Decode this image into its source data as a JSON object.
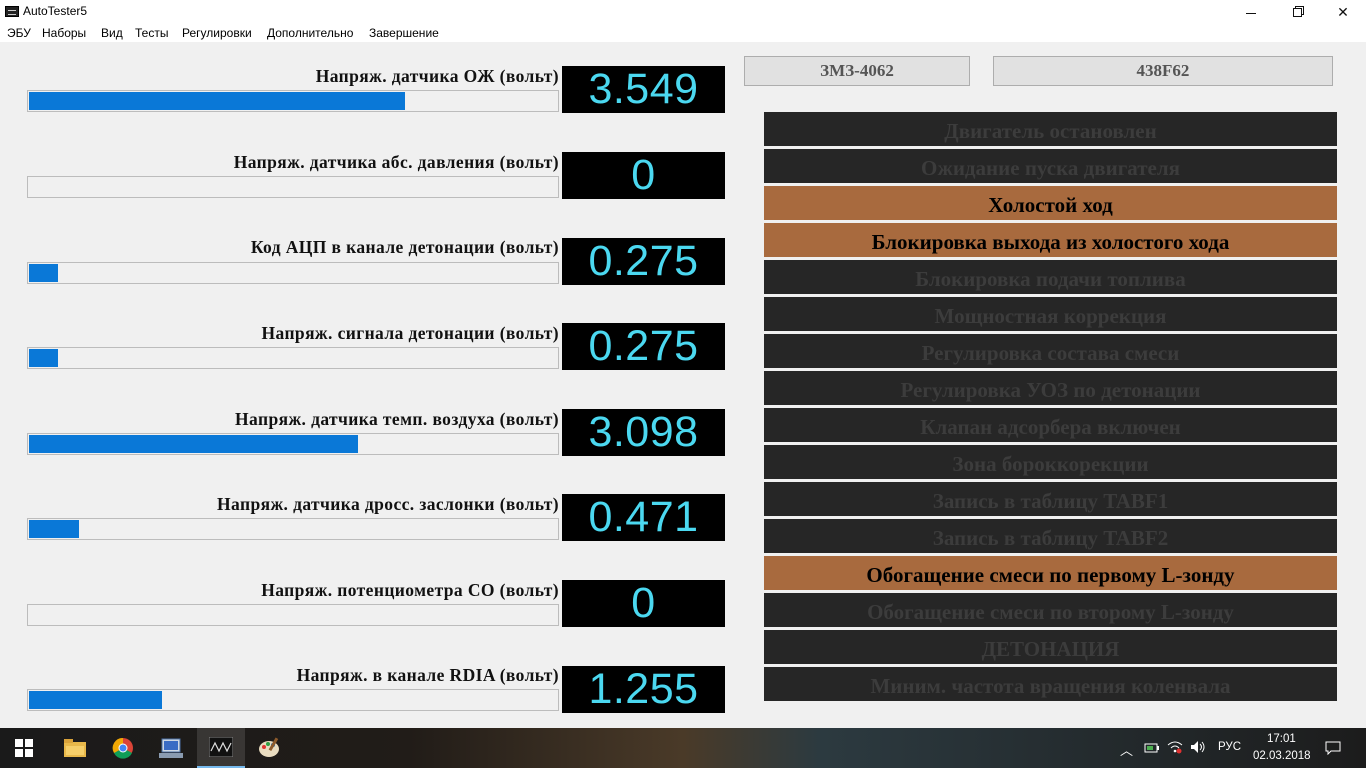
{
  "window": {
    "title": "AutoTester5"
  },
  "menu": [
    "ЭБУ",
    "Наборы",
    "Вид",
    "Тесты",
    "Регулировки",
    "Дополнительно",
    "Завершение"
  ],
  "gauges": [
    {
      "label": "Напряж. датчика ОЖ (вольт)",
      "value": "3.549",
      "fill_fraction": 0.71
    },
    {
      "label": "Напряж. датчика абс. давления (вольт)",
      "value": "0",
      "fill_fraction": 0.0
    },
    {
      "label": "Код АЦП в канале детонации (вольт)",
      "value": "0.275",
      "fill_fraction": 0.055
    },
    {
      "label": "Напряж. сигнала детонации (вольт)",
      "value": "0.275",
      "fill_fraction": 0.055
    },
    {
      "label": "Напряж. датчика темп. воздуха (вольт)",
      "value": "3.098",
      "fill_fraction": 0.62
    },
    {
      "label": "Напряж. датчика дросс. заслонки (вольт)",
      "value": "0.471",
      "fill_fraction": 0.094
    },
    {
      "label": "Напряж. потенциометра СО (вольт)",
      "value": "0",
      "fill_fraction": 0.0
    },
    {
      "label": "Напряж. в канале RDIA (вольт)",
      "value": "1.255",
      "fill_fraction": 0.251
    }
  ],
  "header": {
    "engine": "ЗМЗ-4062",
    "firmware": "438F62"
  },
  "statuses": [
    {
      "label": "Двигатель остановлен",
      "active": false
    },
    {
      "label": "Ожидание пуска двигателя",
      "active": false
    },
    {
      "label": "Холостой ход",
      "active": true
    },
    {
      "label": "Блокировка выхода из холостого хода",
      "active": true
    },
    {
      "label": "Блокировка подачи топлива",
      "active": false
    },
    {
      "label": "Мощностная коррекция",
      "active": false
    },
    {
      "label": "Регулировка состава смеси",
      "active": false
    },
    {
      "label": "Регулировка УОЗ по детонации",
      "active": false
    },
    {
      "label": "Клапан адсорбера включен",
      "active": false
    },
    {
      "label": "Зона бороккорекции",
      "active": false
    },
    {
      "label": "Запись в таблицу TABF1",
      "active": false
    },
    {
      "label": "Запись в таблицу TABF2",
      "active": false
    },
    {
      "label": "Обогащение смеси по первому L-зонду",
      "active": true
    },
    {
      "label": "Обогащение смеси по второму  L-зонду",
      "active": false
    },
    {
      "label": "ДЕТОНАЦИЯ",
      "active": false
    },
    {
      "label": "Миним. частота вращения коленвала",
      "active": false
    }
  ],
  "colors": {
    "fill": "#0a78d7",
    "value_text": "#4bd8f0",
    "status_on": "#a86a3e",
    "status_off": "#262626"
  },
  "taskbar": {
    "language": "РУС",
    "time": "17:01",
    "date": "02.03.2018",
    "icons": [
      "start-icon",
      "file-explorer-icon",
      "chrome-icon",
      "network-app-icon",
      "autotester-icon",
      "paint-icon"
    ]
  }
}
